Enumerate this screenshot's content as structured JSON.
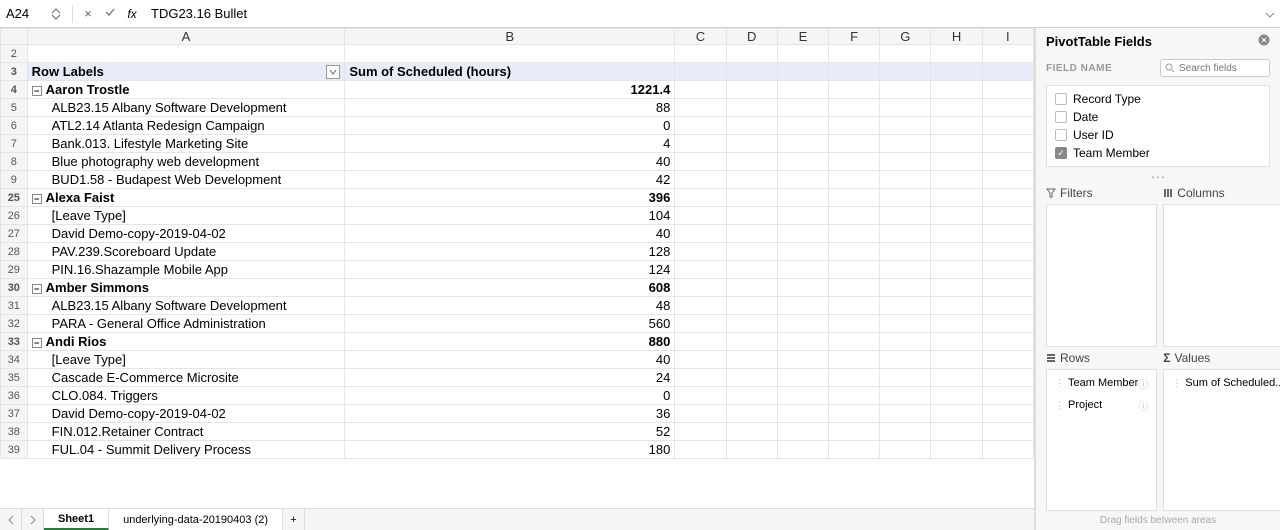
{
  "formula_bar": {
    "cell_ref": "A24",
    "cancel_icon": "×",
    "confirm_icon": "✓",
    "fx": "fx",
    "value": "TDG23.16 Bullet"
  },
  "columns": [
    "A",
    "B",
    "C",
    "D",
    "E",
    "F",
    "G",
    "H",
    "I"
  ],
  "rows": [
    {
      "n": "2",
      "type": "blank"
    },
    {
      "n": "3",
      "type": "header",
      "a": "Row Labels",
      "b": "Sum of Scheduled (hours)"
    },
    {
      "n": "4",
      "type": "group",
      "a": "Aaron Trostle",
      "b": "1221.4"
    },
    {
      "n": "5",
      "type": "child",
      "a": "ALB23.15 Albany Software Development",
      "b": "88"
    },
    {
      "n": "6",
      "type": "child",
      "a": "ATL2.14 Atlanta Redesign Campaign",
      "b": "0"
    },
    {
      "n": "7",
      "type": "child",
      "a": "Bank.013. Lifestyle Marketing Site",
      "b": "4"
    },
    {
      "n": "8",
      "type": "child",
      "a": "Blue photography web development",
      "b": "40"
    },
    {
      "n": "9",
      "type": "child",
      "a": "BUD1.58 - Budapest Web Development",
      "b": "42"
    },
    {
      "n": "25",
      "type": "group",
      "a": "Alexa Faist",
      "b": "396",
      "divider": true
    },
    {
      "n": "26",
      "type": "child",
      "a": "[Leave Type]",
      "b": "104"
    },
    {
      "n": "27",
      "type": "child",
      "a": "David Demo-copy-2019-04-02",
      "b": "40"
    },
    {
      "n": "28",
      "type": "child",
      "a": "PAV.239.Scoreboard Update",
      "b": "128"
    },
    {
      "n": "29",
      "type": "child",
      "a": "PIN.16.Shazample Mobile App",
      "b": "124"
    },
    {
      "n": "30",
      "type": "group",
      "a": "Amber Simmons",
      "b": "608"
    },
    {
      "n": "31",
      "type": "child",
      "a": "ALB23.15 Albany Software Development",
      "b": "48"
    },
    {
      "n": "32",
      "type": "child",
      "a": "PARA - General Office Administration",
      "b": "560"
    },
    {
      "n": "33",
      "type": "group",
      "a": "Andi  Rios",
      "b": "880"
    },
    {
      "n": "34",
      "type": "child",
      "a": "[Leave Type]",
      "b": "40"
    },
    {
      "n": "35",
      "type": "child",
      "a": "Cascade E-Commerce Microsite",
      "b": "24"
    },
    {
      "n": "36",
      "type": "child",
      "a": "CLO.084. Triggers",
      "b": "0"
    },
    {
      "n": "37",
      "type": "child",
      "a": "David Demo-copy-2019-04-02",
      "b": "36"
    },
    {
      "n": "38",
      "type": "child",
      "a": "FIN.012.Retainer Contract",
      "b": "52"
    },
    {
      "n": "39",
      "type": "child",
      "a": "FUL.04 - Summit Delivery Process",
      "b": "180"
    }
  ],
  "tabs": {
    "sheet1": "Sheet1",
    "underlying": "underlying-data-20190403 (2)"
  },
  "panel": {
    "title": "PivotTable Fields",
    "field_name_label": "FIELD NAME",
    "search_placeholder": "Search fields",
    "fields": [
      {
        "label": "Record Type",
        "checked": false
      },
      {
        "label": "Date",
        "checked": false
      },
      {
        "label": "User ID",
        "checked": false
      },
      {
        "label": "Team Member",
        "checked": true
      }
    ],
    "filters_label": "Filters",
    "columns_label": "Columns",
    "rows_label": "Rows",
    "values_label": "Values",
    "row_pills": [
      "Team Member",
      "Project"
    ],
    "value_pills": [
      "Sum of Scheduled..."
    ],
    "footer": "Drag fields between areas"
  }
}
